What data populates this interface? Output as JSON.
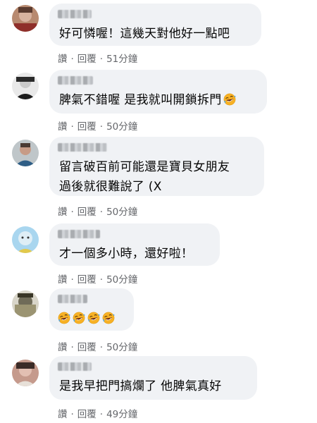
{
  "actions": {
    "like": "讚",
    "reply": "回覆",
    "separator": "·"
  },
  "comments": [
    {
      "text": "好可憐喔！這幾天對他好一點吧",
      "time": "51分鐘"
    },
    {
      "text": "脾氣不錯喔 是我就叫開鎖拆門",
      "emoji": "rofl-emoji",
      "time": "50分鐘"
    },
    {
      "lines": [
        "留言破百前可能還是寶貝女朋友",
        "過後就很難說了 (X"
      ],
      "time": "50分鐘"
    },
    {
      "text": "才一個多小時，還好啦！",
      "time": "50分鐘"
    },
    {
      "emoji_count": 4,
      "emoji": "rofl-emoji",
      "time": "50分鐘"
    },
    {
      "text": "是我早把門搞爛了 他脾氣真好",
      "time": "49分鐘"
    }
  ]
}
